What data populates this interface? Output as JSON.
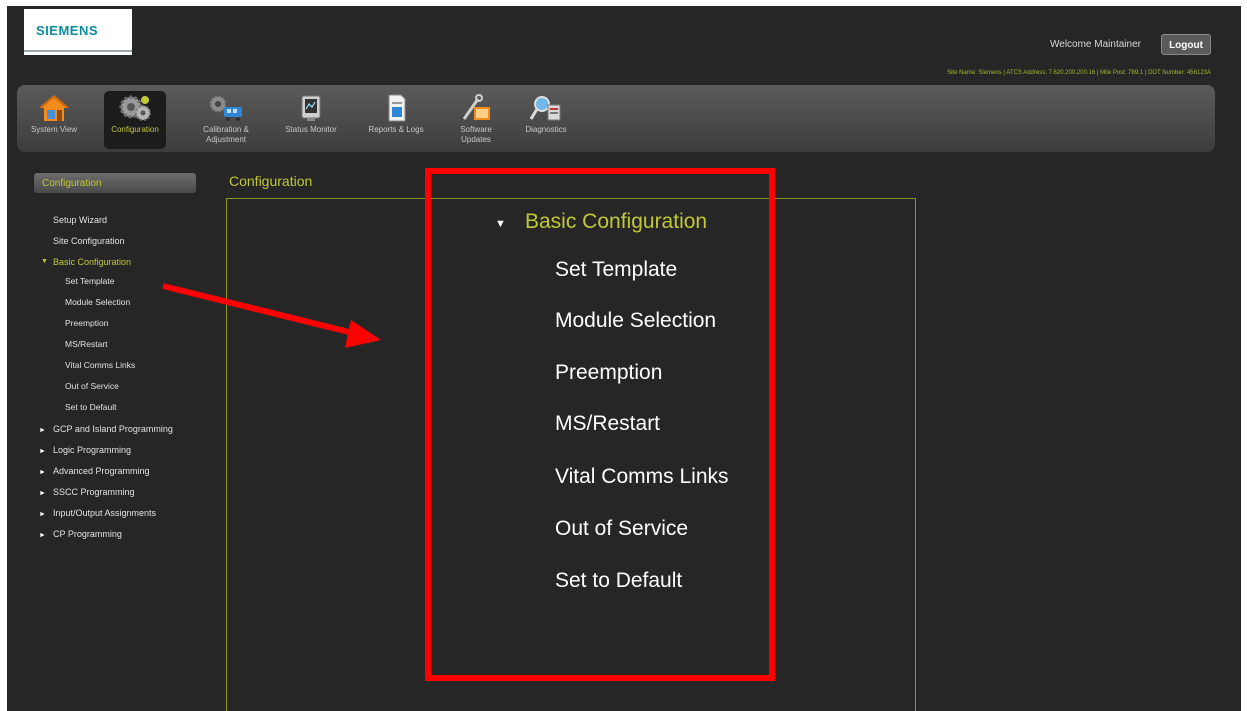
{
  "brand": {
    "logo_text": "SIEMENS"
  },
  "header": {
    "welcome": "Welcome Maintainer",
    "logout_label": "Logout",
    "site_info": "Site Name: Siemens | ATCS Address: 7.620.200.200.16 | Mile Post: 789.1 | DOT Number: 456123A"
  },
  "toolbar": {
    "items": [
      {
        "label_line1": "System View",
        "label_line2": "",
        "icon": "house-icon"
      },
      {
        "label_line1": "Configuration",
        "label_line2": "",
        "icon": "gears-icon",
        "active": true
      },
      {
        "label_line1": "Calibration &",
        "label_line2": "Adjustment",
        "icon": "calibration-icon"
      },
      {
        "label_line1": "Status Monitor",
        "label_line2": "",
        "icon": "monitor-icon"
      },
      {
        "label_line1": "Reports & Logs",
        "label_line2": "",
        "icon": "report-icon"
      },
      {
        "label_line1": "Software",
        "label_line2": "Updates",
        "icon": "software-update-icon"
      },
      {
        "label_line1": "Diagnostics",
        "label_line2": "",
        "icon": "diagnostics-icon"
      }
    ]
  },
  "sidebar": {
    "header": "Configuration",
    "items": [
      {
        "label": "Setup Wizard"
      },
      {
        "label": "Site Configuration"
      },
      {
        "label": "Basic Configuration",
        "expanded": true
      },
      {
        "label": "Set Template"
      },
      {
        "label": "Module Selection"
      },
      {
        "label": "Preemption"
      },
      {
        "label": "MS/Restart"
      },
      {
        "label": "Vital Comms Links"
      },
      {
        "label": "Out of Service"
      },
      {
        "label": "Set to Default"
      },
      {
        "label": "GCP and Island Programming"
      },
      {
        "label": "Logic Programming"
      },
      {
        "label": "Advanced Programming"
      },
      {
        "label": "SSCC Programming"
      },
      {
        "label": "Input/Output Assignments"
      },
      {
        "label": "CP Programming"
      }
    ]
  },
  "main": {
    "title": "Configuration"
  },
  "callout": {
    "title": "Basic Configuration",
    "items": [
      "Set Template",
      "Module Selection",
      "Preemption",
      "MS/Restart",
      "Vital Comms Links",
      "Out of Service",
      "Set to Default"
    ]
  },
  "colors": {
    "accent": "#c2c834",
    "callout_border": "#ff0000",
    "background": "#262626"
  }
}
